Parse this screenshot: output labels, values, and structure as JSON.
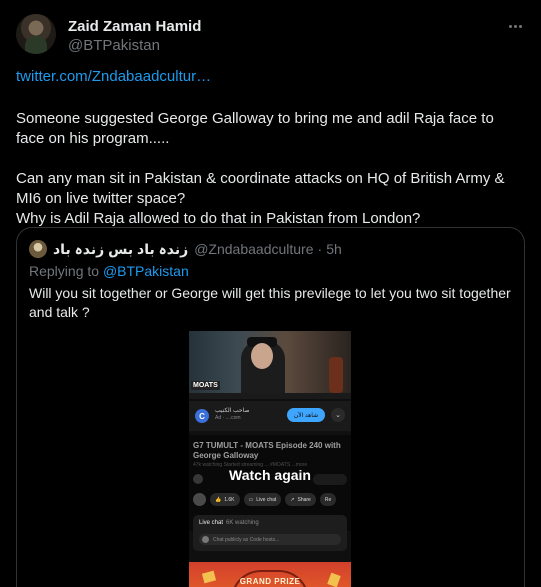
{
  "author": {
    "name": "Zaid Zaman Hamid",
    "handle": "@BTPakistan"
  },
  "tweet": {
    "link": "twitter.com/Zndabaadcultur…",
    "paragraphs": [
      "Someone suggested George Galloway to bring me and adil Raja face to face on his program.....",
      "Can any man sit in Pakistan & coordinate attacks on HQ of British Army & MI6 on live twitter space?",
      "Why is Adil Raja allowed to do that in Pakistan from London?"
    ]
  },
  "quote": {
    "name": "زندہ باد بس زندہ باد",
    "handle": "@Zndabaadculture",
    "separator": "·",
    "time": "5h",
    "replying_label": "Replying to",
    "replying_to": "@BTPakistan",
    "text": "Will you sit together or George will get this previlege to let you two sit together and talk ?",
    "media": {
      "channel_logo_text": "MOATS",
      "ad_logo": "C",
      "ad_name": "صاحب الكنيب",
      "ad_label": "Ad · ....com",
      "ad_button": "شاهد الآن",
      "ad_chevron": "⌄",
      "video_title": "G7 TUMULT - MOATS Episode 240 with George Galloway",
      "video_meta": "47k watching  Started streaming ... #MOATS  ...more",
      "watch_again": "Watch again",
      "likes": "1.6K",
      "live_chat_button": "Live chat",
      "share_button": "Share",
      "more_button": "Re",
      "live_chat_title": "Live chat",
      "live_chat_watching": "6K watching",
      "chat_placeholder": "Chat publicly as Code hosts...",
      "promo_text": "GRAND PRIZE"
    }
  }
}
